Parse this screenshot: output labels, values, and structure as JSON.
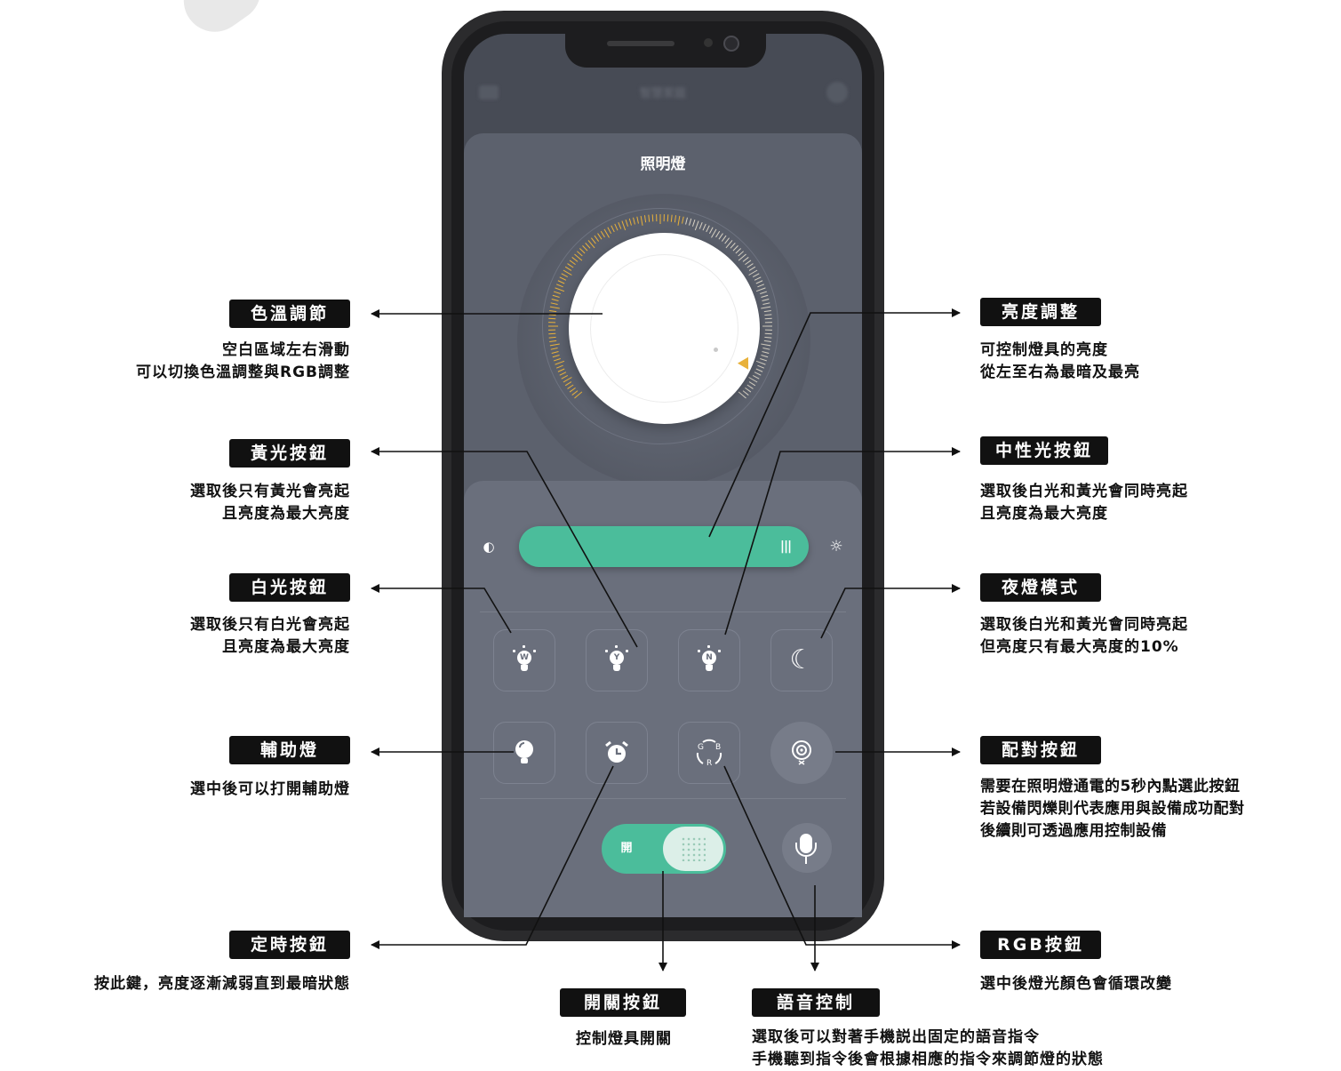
{
  "app": {
    "sheet_title": "照明燈",
    "header_title": "智慧家庭",
    "toggle_label": "開"
  },
  "brightness": {
    "level": 0.88,
    "handle_glyph": "|||"
  },
  "icons": {
    "brightness_min": "◐",
    "brightness_max": "☼",
    "moon": "☾",
    "bulb_white": "W",
    "bulb_yellow": "Y",
    "bulb_neutral": "N",
    "rgb_letters": [
      "G",
      "B",
      "R"
    ]
  },
  "annotations": {
    "color_temp": {
      "title": "色溫調節",
      "desc": [
        "空白區域左右滑動",
        "可以切換色溫調整與RGB調整"
      ]
    },
    "yellow": {
      "title": "黃光按鈕",
      "desc": [
        "選取後只有黃光會亮起",
        "且亮度為最大亮度"
      ]
    },
    "white": {
      "title": "白光按鈕",
      "desc": [
        "選取後只有白光會亮起",
        "且亮度為最大亮度"
      ]
    },
    "aux": {
      "title": "輔助燈",
      "desc": [
        "選中後可以打開輔助燈"
      ]
    },
    "timer": {
      "title": "定時按鈕",
      "desc": [
        "按此鍵，亮度逐漸減弱直到最暗狀態"
      ]
    },
    "power": {
      "title": "開關按鈕",
      "desc": [
        "控制燈具開關"
      ]
    },
    "voice": {
      "title": "語音控制",
      "desc": [
        "選取後可以對著手機説出固定的語音指令",
        "手機聽到指令後會根據相應的指令來調節燈的狀態"
      ]
    },
    "brightness": {
      "title": "亮度調整",
      "desc": [
        "可控制燈具的亮度",
        "從左至右為最暗及最亮"
      ]
    },
    "neutral": {
      "title": "中性光按鈕",
      "desc": [
        "選取後白光和黃光會同時亮起",
        "且亮度為最大亮度"
      ]
    },
    "night": {
      "title": "夜燈模式",
      "desc": [
        "選取後白光和黃光會同時亮起",
        "但亮度只有最大亮度的10%"
      ]
    },
    "pair": {
      "title": "配對按鈕",
      "desc": [
        "需要在照明燈通電的5秒內點選此按鈕",
        "若設備閃爍則代表應用與設備成功配對",
        "後續則可透過應用控制設備"
      ]
    },
    "rgb": {
      "title": "RGB按鈕",
      "desc": [
        "選中後燈光顏色會循環改變"
      ]
    }
  },
  "colors": {
    "accent_green": "#4bbd9b",
    "dial_orange": "#e8b13a",
    "panel": "#6a6f7c",
    "label_bg": "#111111"
  }
}
